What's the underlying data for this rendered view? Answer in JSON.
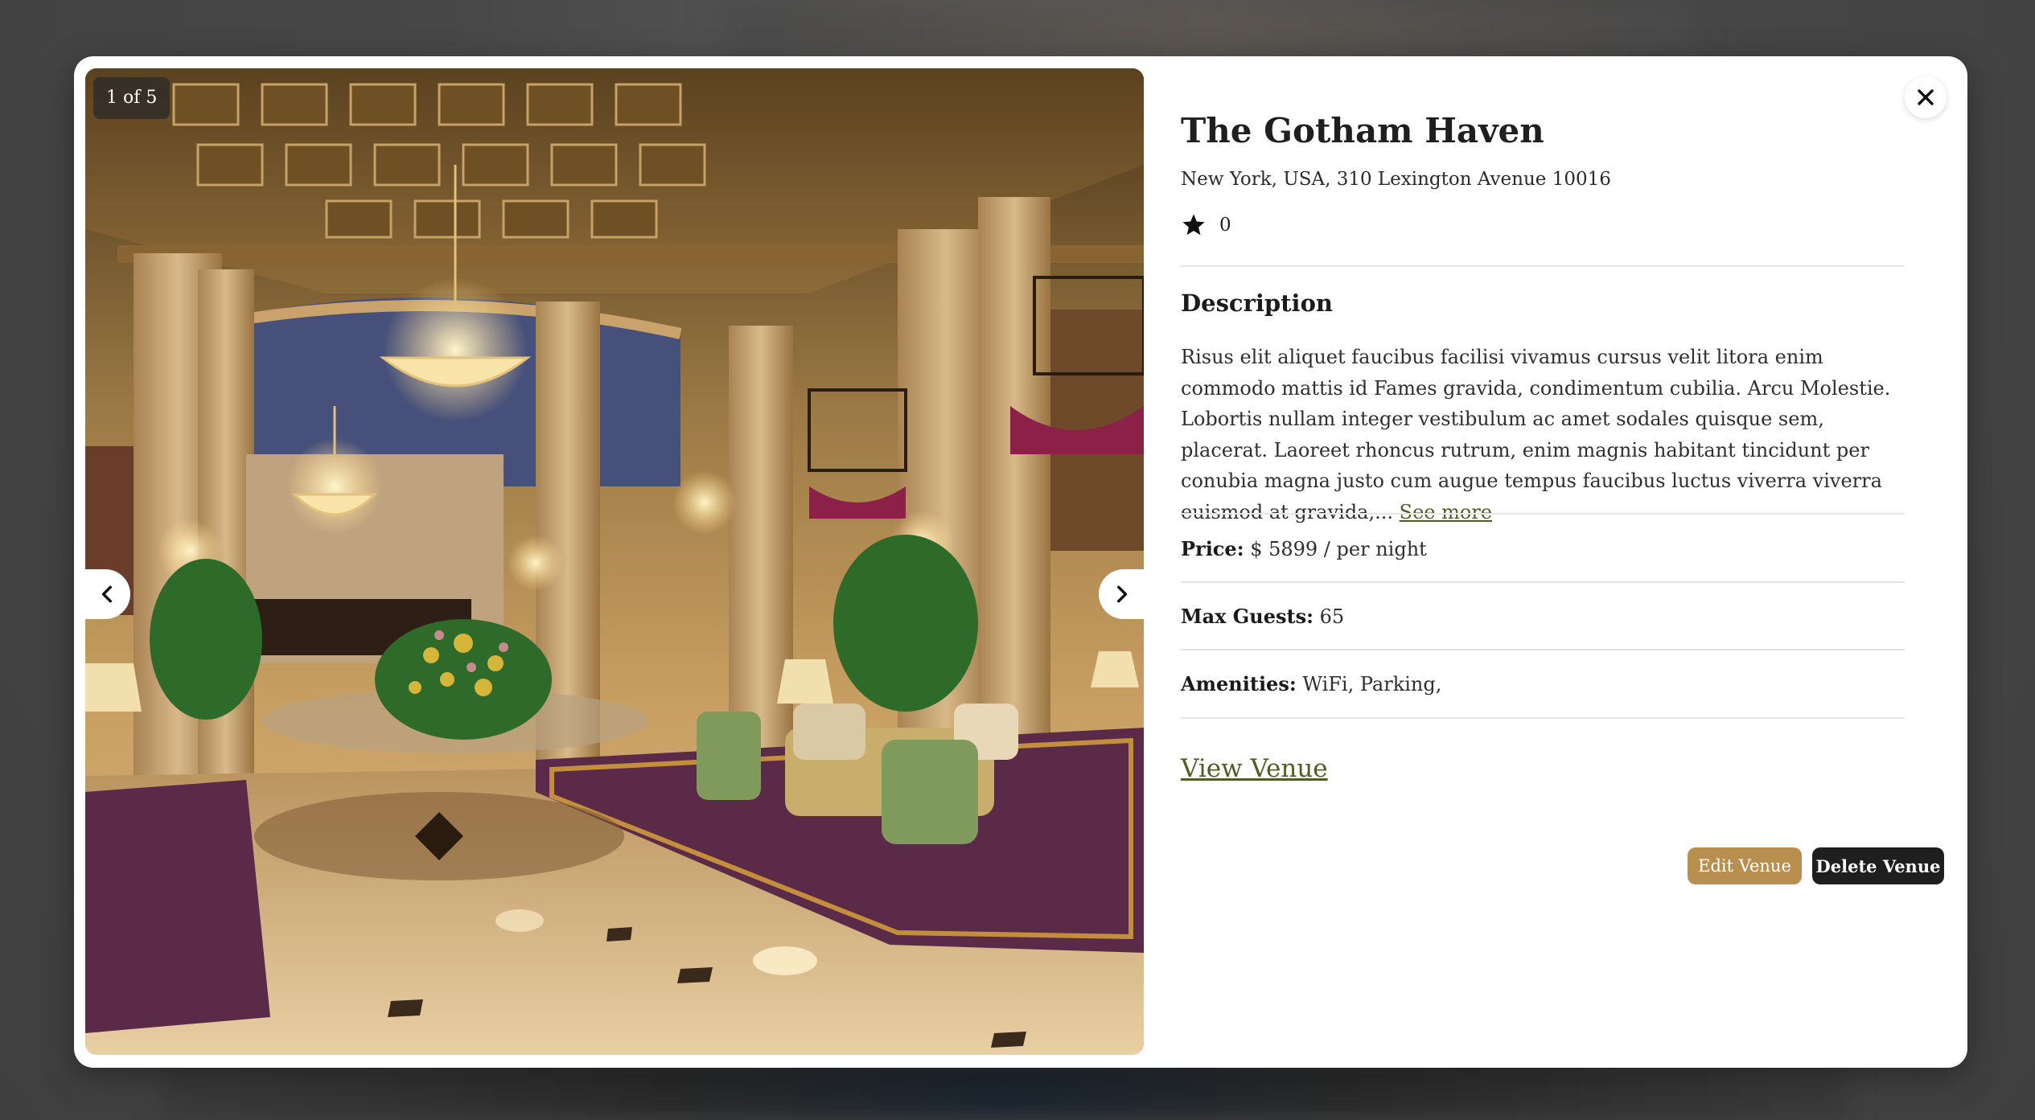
{
  "gallery": {
    "counter": "1 of 5",
    "photo_alt": "Ornate hotel lobby with chandeliers, columns, flower arrangement and lounge seating"
  },
  "venue": {
    "name": "The Gotham Haven",
    "address": "New York, USA, 310 Lexington Avenue 10016",
    "rating": "0"
  },
  "description": {
    "heading": "Description",
    "text": "Risus elit aliquet faucibus facilisi vivamus cursus velit litora enim commodo mattis id Fames gravida, condimentum cubilia. Arcu Molestie. Lobortis nullam integer vestibulum ac amet sodales quisque sem, placerat. Laoreet rhoncus rutrum, enim magnis habitant tincidunt per conubia magna justo cum augue tempus faucibus luctus viverra viverra euismod at gravida,...",
    "see_more": "See more"
  },
  "details": {
    "price_label": "Price:",
    "price_value": "$ 5899 / per night",
    "guests_label": "Max Guests:",
    "guests_value": "65",
    "amenities_label": "Amenities:",
    "amenities_value": "WiFi, Parking,"
  },
  "actions": {
    "view": "View Venue",
    "edit": "Edit Venue",
    "delete": "Delete Venue"
  },
  "icons": {
    "prev": "chevron-left-icon",
    "next": "chevron-right-icon",
    "close": "close-icon",
    "rating": "star-icon"
  },
  "colors": {
    "accent_link": "#4d5d23",
    "edit_button": "#b88f4f",
    "delete_button": "#1f1f1f"
  }
}
